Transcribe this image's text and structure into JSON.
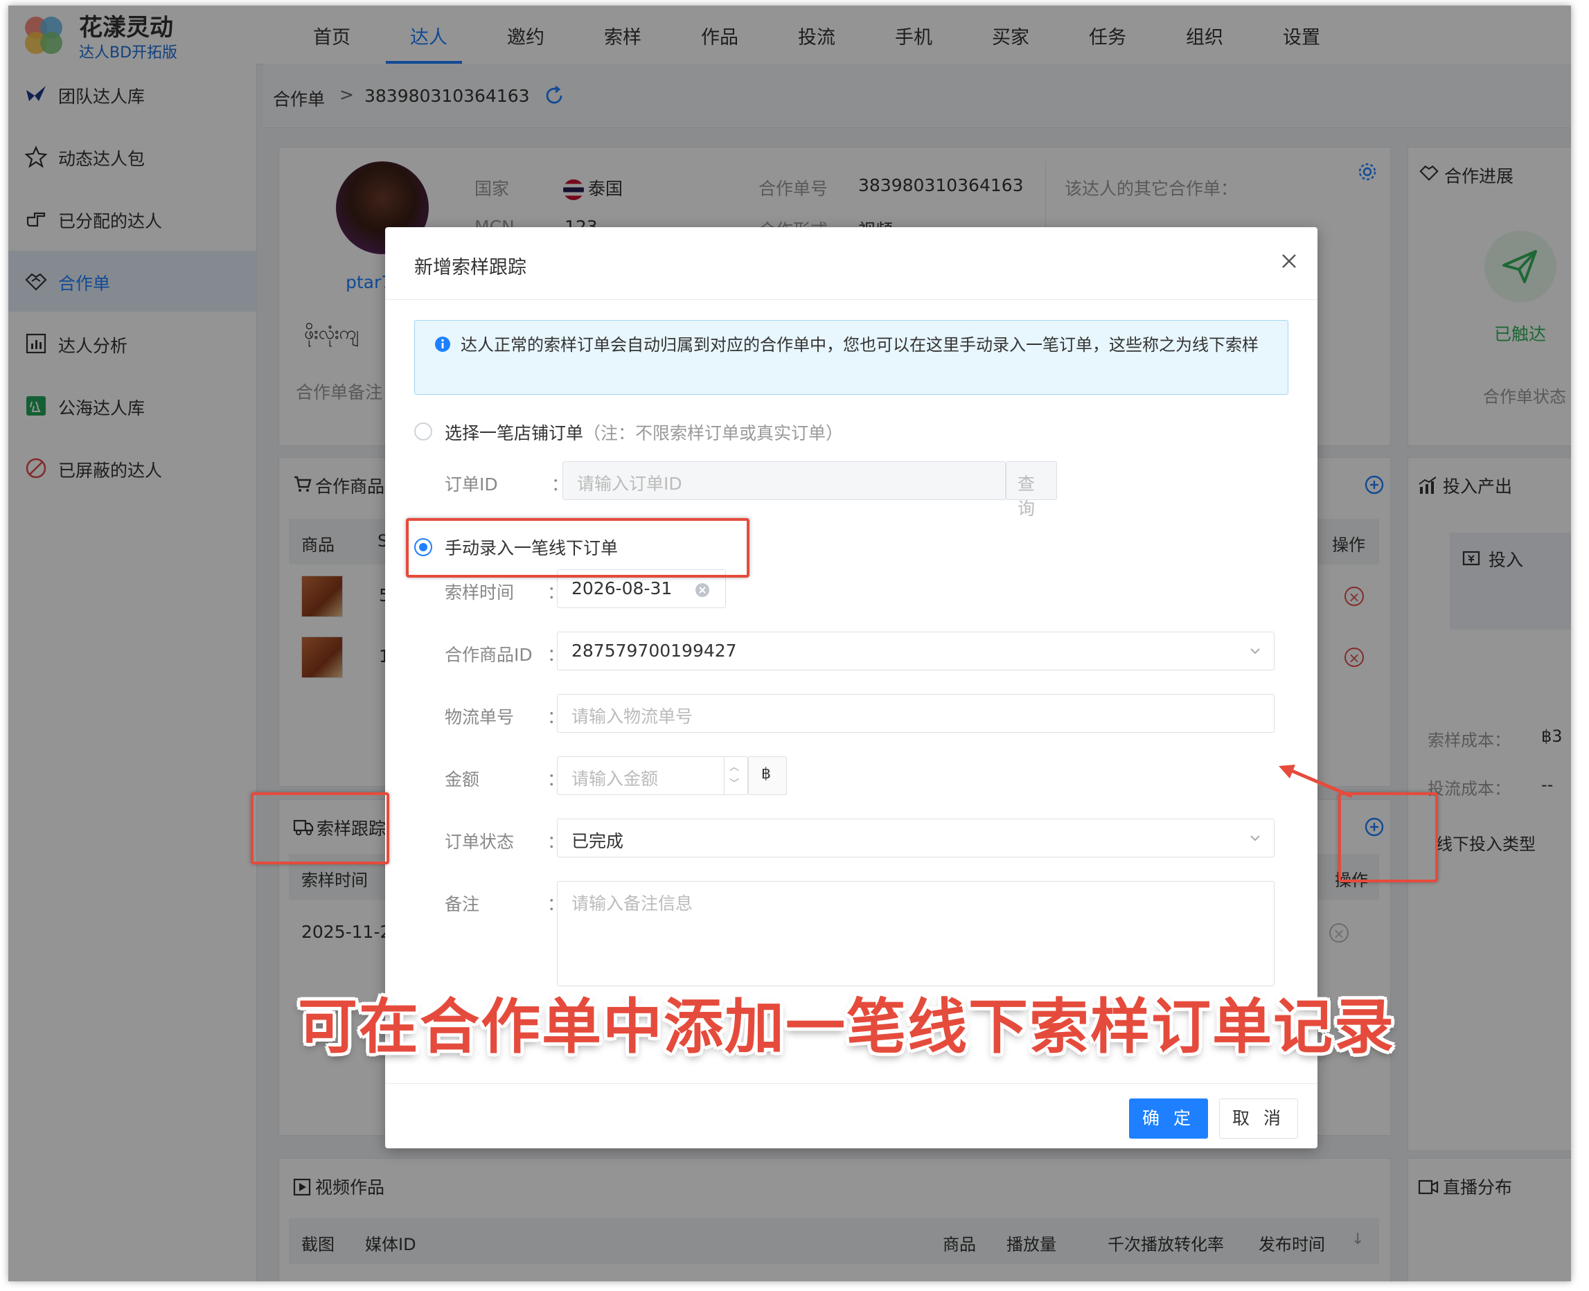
{
  "brand": {
    "name": "花漾灵动",
    "subtitle": "达人BD开拓版"
  },
  "nav": [
    {
      "label": "首页"
    },
    {
      "label": "达人"
    },
    {
      "label": "邀约"
    },
    {
      "label": "索样"
    },
    {
      "label": "作品"
    },
    {
      "label": "投流"
    },
    {
      "label": "手机"
    },
    {
      "label": "买家"
    },
    {
      "label": "任务"
    },
    {
      "label": "组织"
    },
    {
      "label": "设置"
    }
  ],
  "active_nav": "达人",
  "sidebar": [
    {
      "label": "团队达人库",
      "icon": "bird-icon"
    },
    {
      "label": "动态达人包",
      "icon": "star-icon"
    },
    {
      "label": "已分配的达人",
      "icon": "hand-point-icon"
    },
    {
      "label": "合作单",
      "icon": "handshake-icon"
    },
    {
      "label": "达人分析",
      "icon": "bar-chart-icon"
    },
    {
      "label": "公海达人库",
      "icon": "public-pool-icon"
    },
    {
      "label": "已屏蔽的达人",
      "icon": "ban-icon"
    }
  ],
  "breadcrumb": {
    "root": "合作单",
    "separator": ">",
    "current": "383980310364163"
  },
  "profile": {
    "country_label": "国家",
    "country_value": "泰国",
    "order_no_label": "合作单号",
    "order_no_value": "383980310364163",
    "other_orders_label": "该达人的其它合作单：",
    "mcn_label": "MCN",
    "mcn_value": "123",
    "form_label": "合作形式",
    "form_value": "视频",
    "handle": "ptar7",
    "name_script": "ဖိုးလုံးကျ",
    "remark_label": "合作单备注"
  },
  "progress": {
    "title": "合作进展",
    "reached": "已触达",
    "status_label": "合作单状态"
  },
  "products": {
    "title": "合作商品",
    "col_product": "商品",
    "col_s": "S",
    "col_ops": "操作",
    "rows": [
      {
        "num": "5"
      },
      {
        "num": "1"
      }
    ]
  },
  "io": {
    "title": "投入产出",
    "invest": "投入",
    "sample_cost_label": "索样成本：",
    "sample_cost_value": "฿3",
    "traffic_cost_label": "投流成本：",
    "traffic_cost_value": "--",
    "offline_type": "线下投入类型"
  },
  "sample_track": {
    "title": "索样跟踪",
    "col_time": "索样时间",
    "col_ops": "操作",
    "row_time": "2025-11-2"
  },
  "videos": {
    "title": "视频作品",
    "cols": [
      "截图",
      "媒体ID",
      "商品",
      "播放量",
      "千次播放转化率",
      "发布时间"
    ]
  },
  "live": {
    "title": "直播分布"
  },
  "modal": {
    "title": "新增索样跟踪",
    "notice": "达人正常的索样订单会自动归属到对应的合作单中，您也可以在这里手动录入一笔订单，这些称之为线下索样",
    "option1_label": "选择一笔店铺订单",
    "option1_note": "（注：不限索样订单或真实订单）",
    "order_id_label": "订单ID",
    "order_id_placeholder": "请输入订单ID",
    "query_btn": "查 询",
    "option2_label": "手动录入一笔线下订单",
    "colon": "：",
    "sample_time_label": "索样时间",
    "sample_time_value": "2026-08-31",
    "product_id_label": "合作商品ID",
    "product_id_value": "287579700199427",
    "tracking_label": "物流单号",
    "tracking_placeholder": "请输入物流单号",
    "amount_label": "金额",
    "amount_placeholder": "请输入金额",
    "currency": "฿",
    "status_label": "订单状态",
    "status_value": "已完成",
    "remark_label": "备注",
    "remark_placeholder": "请输入备注信息",
    "ok_btn": "确 定",
    "cancel_btn": "取 消"
  },
  "annotation": "可在合作单中添加一笔线下索样订单记录",
  "colors": {
    "accent": "#1e80ff",
    "highlight": "#e54b3c",
    "reached": "#33b35a"
  }
}
